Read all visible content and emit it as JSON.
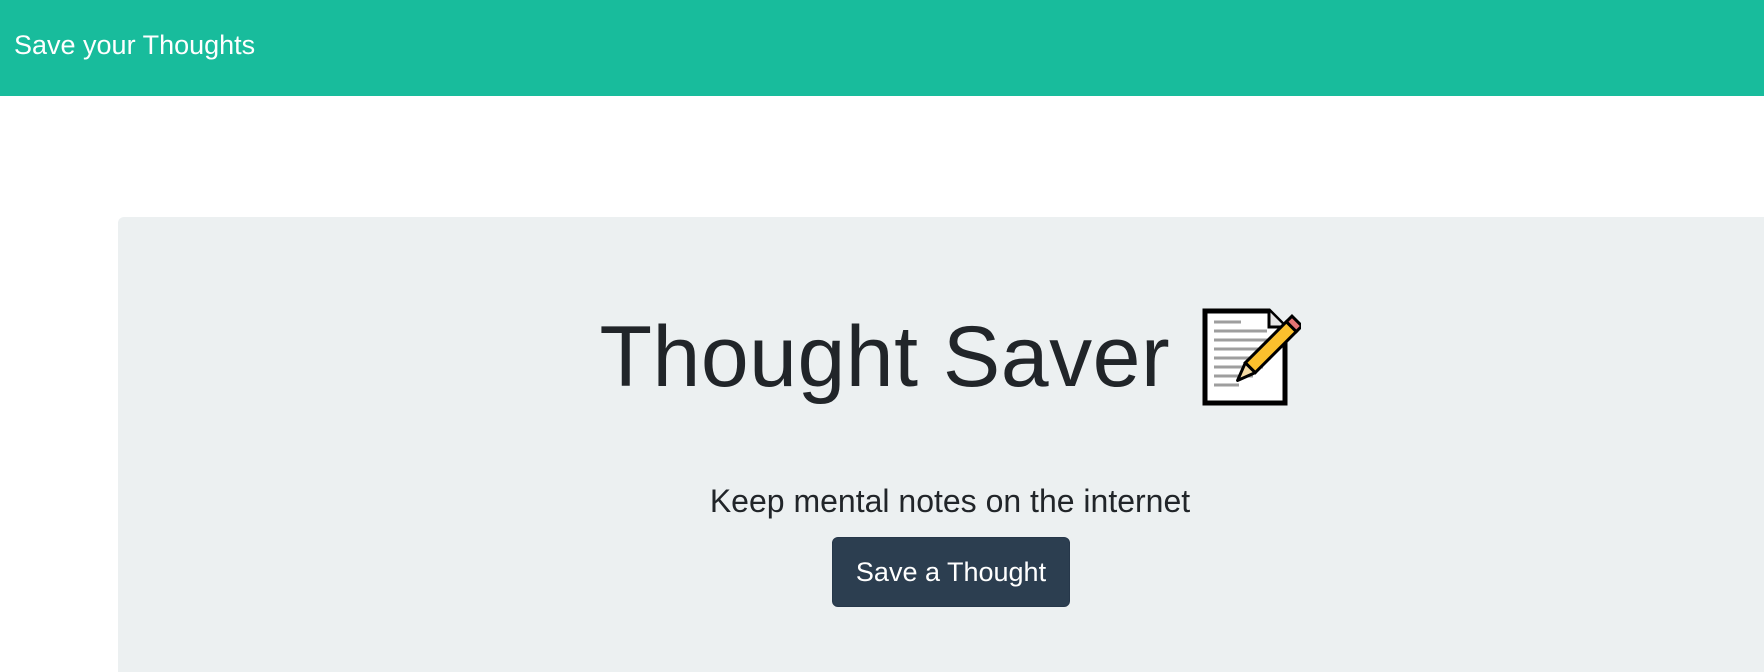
{
  "navbar": {
    "brand": "Save your Thoughts",
    "background": "#18bc9c"
  },
  "hero": {
    "title": "Thought Saver",
    "title_icon": "memo-icon",
    "subtitle": "Keep mental notes on the internet",
    "cta_label": "Save a Thought",
    "background": "#ecf0f1",
    "cta_color": "#2c3e50"
  }
}
